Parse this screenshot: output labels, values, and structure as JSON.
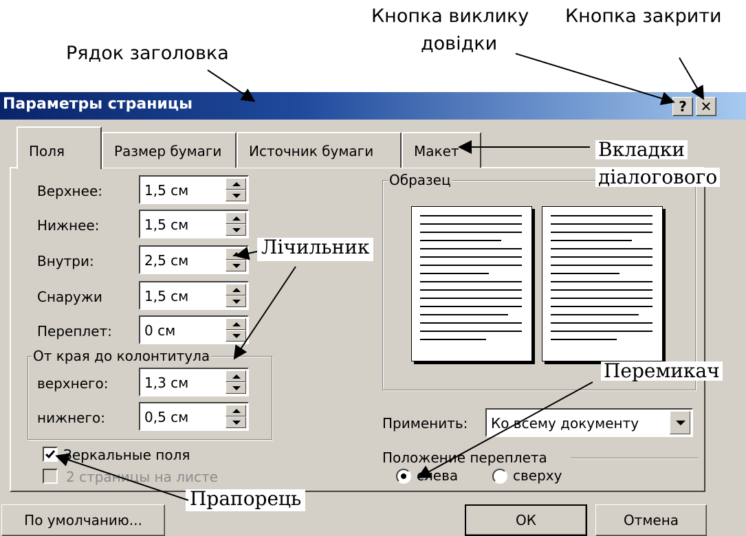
{
  "annotations": {
    "title_bar": "Рядок заголовка",
    "help_button_line1": "Кнопка виклику",
    "help_button_line2": "довідки",
    "close_button": "Кнопка закрити",
    "tabs_line1": "Вкладки",
    "tabs_line2": "діалогового",
    "spinner": "Лічильник",
    "radio_switch": "Перемикач",
    "checkbox_flag": "Прапорець"
  },
  "window": {
    "title": "Параметры страницы",
    "help_glyph": "?",
    "close_glyph": "✕"
  },
  "tabs": [
    {
      "label": "Поля",
      "active": true
    },
    {
      "label": "Размер бумаги",
      "active": false
    },
    {
      "label": "Источник бумаги",
      "active": false
    },
    {
      "label": "Макет",
      "active": false
    }
  ],
  "fields": [
    {
      "label": "Верхнее:",
      "value": "1,5 см"
    },
    {
      "label": "Нижнее:",
      "value": "1,5 см"
    },
    {
      "label": "Внутри:",
      "value": "2,5 см"
    },
    {
      "label": "Снаружи",
      "value": "1,5 см"
    },
    {
      "label": "Переплет:",
      "value": "0 см"
    }
  ],
  "header_footer_group": {
    "legend": "От края до колонтитула",
    "fields": [
      {
        "label": "верхнего:",
        "value": "1,3 см"
      },
      {
        "label": "нижнего:",
        "value": "0,5 см"
      }
    ]
  },
  "checkboxes": [
    {
      "label": "Зеркальные поля",
      "checked": true,
      "enabled": true
    },
    {
      "label": "2 страницы на листе",
      "checked": false,
      "enabled": false
    }
  ],
  "preview": {
    "legend": "Образец"
  },
  "apply": {
    "label": "Применить:",
    "value": "Ко всему документу"
  },
  "gutter_position": {
    "legend": "Положение переплета",
    "options": [
      {
        "label": "слева",
        "selected": true
      },
      {
        "label": "сверху",
        "selected": false
      }
    ]
  },
  "buttons": {
    "default": "По умолчанию...",
    "ok": "ОК",
    "cancel": "Отмена"
  },
  "colors": {
    "titlebar_start": "#0a246a",
    "titlebar_end": "#a6caf0",
    "dialog_face": "#d4d0c8"
  }
}
